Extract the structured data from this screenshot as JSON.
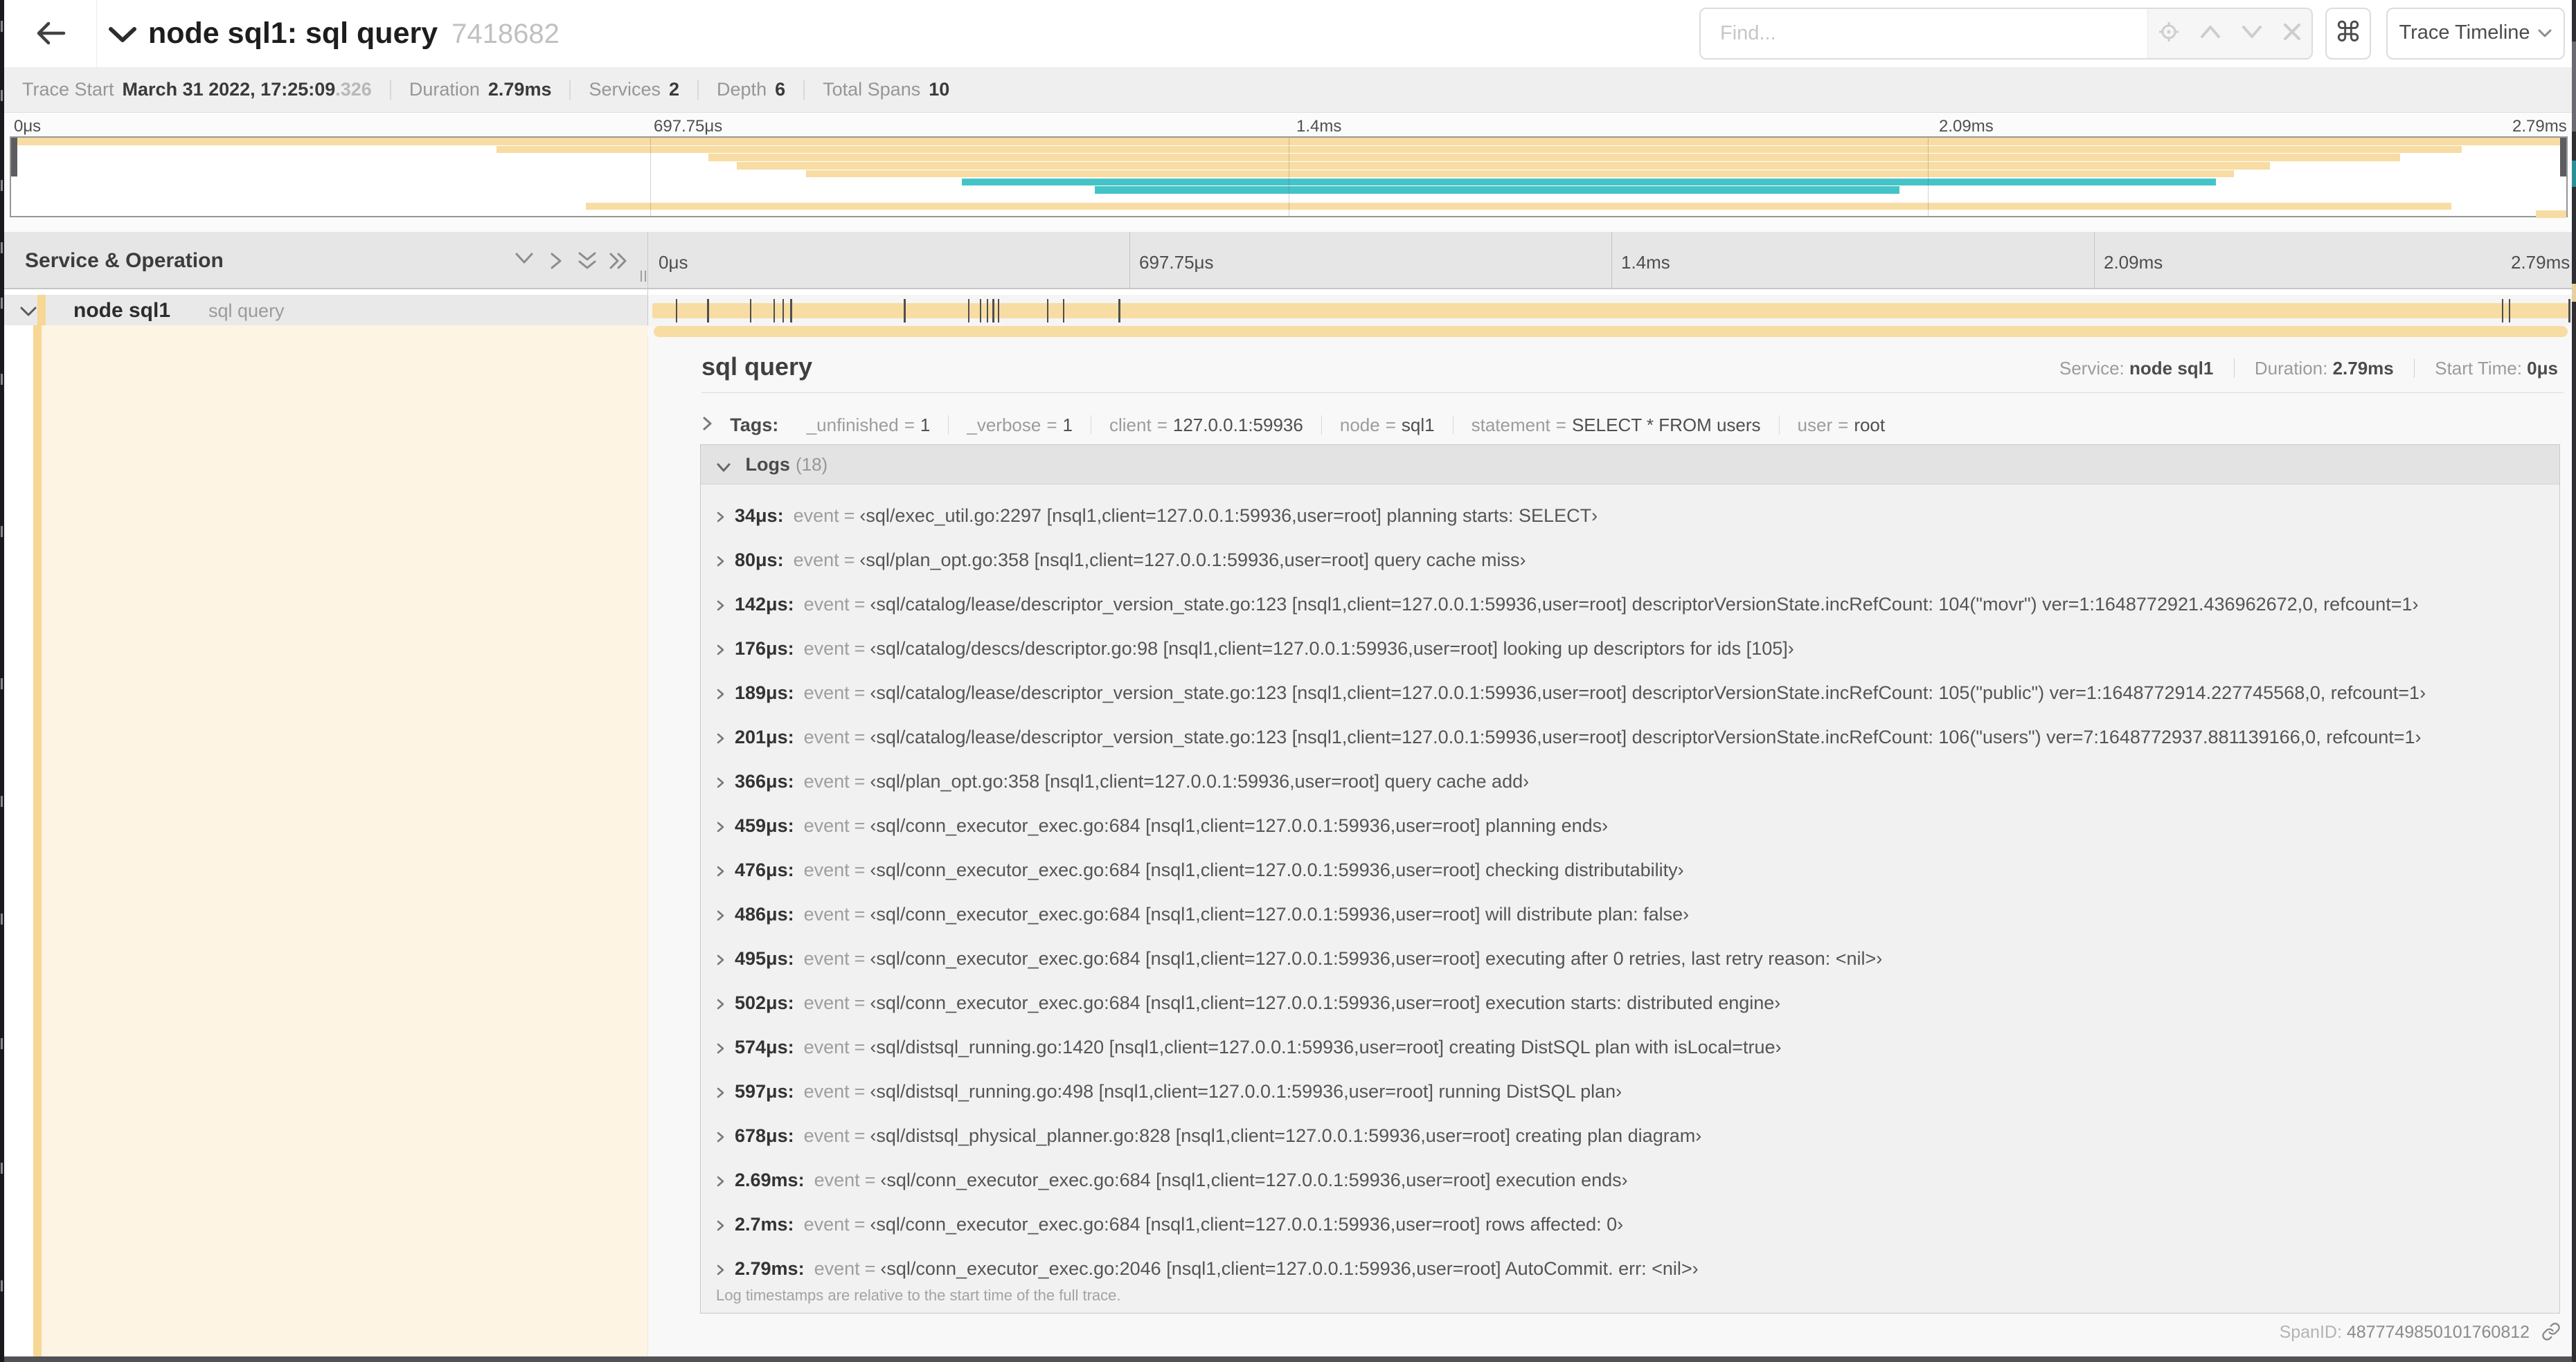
{
  "header": {
    "back": "←",
    "title": "node sql1: sql query",
    "trace_id": "7418682",
    "find_placeholder": "Find...",
    "cmd_label": "⌘",
    "view_dropdown": "Trace Timeline"
  },
  "stats": {
    "trace_start_label": "Trace Start",
    "trace_start": "March 31 2022, 17:25:09",
    "trace_start_frac": ".326",
    "duration_label": "Duration",
    "duration": "2.79ms",
    "services_label": "Services",
    "services": "2",
    "depth_label": "Depth",
    "depth": "6",
    "total_spans_label": "Total Spans",
    "total_spans": "10"
  },
  "colors": {
    "span_tan": "#f7dca3",
    "span_teal": "#45c4c8"
  },
  "minimap": {
    "ticks": [
      "0μs",
      "697.75μs",
      "1.4ms",
      "2.09ms",
      "2.79ms"
    ],
    "spans": [
      {
        "row": 0,
        "start": 0.0,
        "end": 1.0,
        "color": "tan"
      },
      {
        "row": 1,
        "start": 0.19,
        "end": 0.959,
        "color": "tan"
      },
      {
        "row": 2,
        "start": 0.273,
        "end": 0.935,
        "color": "tan"
      },
      {
        "row": 3,
        "start": 0.284,
        "end": 0.884,
        "color": "tan"
      },
      {
        "row": 4,
        "start": 0.311,
        "end": 0.87,
        "color": "tan"
      },
      {
        "row": 5,
        "start": 0.372,
        "end": 0.863,
        "color": "teal"
      },
      {
        "row": 6,
        "start": 0.424,
        "end": 0.739,
        "color": "teal"
      },
      {
        "row": 8,
        "start": 0.225,
        "end": 0.955,
        "color": "tan"
      },
      {
        "row": 9,
        "start": 0.988,
        "end": 1.0,
        "color": "tan"
      }
    ]
  },
  "timeline": {
    "left_header": "Service & Operation",
    "ticks": [
      "0μs",
      "697.75μs",
      "1.4ms",
      "2.09ms",
      "2.79ms"
    ]
  },
  "span_row": {
    "service": "node sql1",
    "operation": "sql query",
    "event_fractions": [
      0.0122,
      0.0287,
      0.0509,
      0.0631,
      0.0677,
      0.072,
      0.1312,
      0.1645,
      0.1706,
      0.1742,
      0.1774,
      0.18,
      0.2057,
      0.214,
      0.243,
      0.9642,
      0.9677,
      0.999
    ]
  },
  "detail": {
    "title": "sql query",
    "service_label": "Service:",
    "service": "node sql1",
    "duration_label": "Duration:",
    "duration": "2.79ms",
    "start_time_label": "Start Time:",
    "start_time": "0μs",
    "tags_label": "Tags:",
    "tags": [
      {
        "key": "_unfinished",
        "value": "1"
      },
      {
        "key": "_verbose",
        "value": "1"
      },
      {
        "key": "client",
        "value": "127.0.0.1:59936"
      },
      {
        "key": "node",
        "value": "sql1"
      },
      {
        "key": "statement",
        "value": "SELECT * FROM users"
      },
      {
        "key": "user",
        "value": "root"
      }
    ],
    "logs_label": "Logs",
    "logs_count": "(18)",
    "log_field": "event",
    "logs": [
      {
        "time": "34μs:",
        "value": "‹sql/exec_util.go:2297 [nsql1,client=127.0.0.1:59936,user=root] planning starts: SELECT›"
      },
      {
        "time": "80μs:",
        "value": "‹sql/plan_opt.go:358 [nsql1,client=127.0.0.1:59936,user=root] query cache miss›"
      },
      {
        "time": "142μs:",
        "value": "‹sql/catalog/lease/descriptor_version_state.go:123 [nsql1,client=127.0.0.1:59936,user=root] descriptorVersionState.incRefCount: 104(\"movr\") ver=1:1648772921.436962672,0, refcount=1›"
      },
      {
        "time": "176μs:",
        "value": "‹sql/catalog/descs/descriptor.go:98 [nsql1,client=127.0.0.1:59936,user=root] looking up descriptors for ids [105]›"
      },
      {
        "time": "189μs:",
        "value": "‹sql/catalog/lease/descriptor_version_state.go:123 [nsql1,client=127.0.0.1:59936,user=root] descriptorVersionState.incRefCount: 105(\"public\") ver=1:1648772914.227745568,0, refcount=1›"
      },
      {
        "time": "201μs:",
        "value": "‹sql/catalog/lease/descriptor_version_state.go:123 [nsql1,client=127.0.0.1:59936,user=root] descriptorVersionState.incRefCount: 106(\"users\") ver=7:1648772937.881139166,0, refcount=1›"
      },
      {
        "time": "366μs:",
        "value": "‹sql/plan_opt.go:358 [nsql1,client=127.0.0.1:59936,user=root] query cache add›"
      },
      {
        "time": "459μs:",
        "value": "‹sql/conn_executor_exec.go:684 [nsql1,client=127.0.0.1:59936,user=root] planning ends›"
      },
      {
        "time": "476μs:",
        "value": "‹sql/conn_executor_exec.go:684 [nsql1,client=127.0.0.1:59936,user=root] checking distributability›"
      },
      {
        "time": "486μs:",
        "value": "‹sql/conn_executor_exec.go:684 [nsql1,client=127.0.0.1:59936,user=root] will distribute plan: false›"
      },
      {
        "time": "495μs:",
        "value": "‹sql/conn_executor_exec.go:684 [nsql1,client=127.0.0.1:59936,user=root] executing after 0 retries, last retry reason: <nil>›"
      },
      {
        "time": "502μs:",
        "value": "‹sql/conn_executor_exec.go:684 [nsql1,client=127.0.0.1:59936,user=root] execution starts: distributed engine›"
      },
      {
        "time": "574μs:",
        "value": "‹sql/distsql_running.go:1420 [nsql1,client=127.0.0.1:59936,user=root] creating DistSQL plan with isLocal=true›"
      },
      {
        "time": "597μs:",
        "value": "‹sql/distsql_running.go:498 [nsql1,client=127.0.0.1:59936,user=root] running DistSQL plan›"
      },
      {
        "time": "678μs:",
        "value": "‹sql/distsql_physical_planner.go:828 [nsql1,client=127.0.0.1:59936,user=root] creating plan diagram›"
      },
      {
        "time": "2.69ms:",
        "value": "‹sql/conn_executor_exec.go:684 [nsql1,client=127.0.0.1:59936,user=root] execution ends›"
      },
      {
        "time": "2.7ms:",
        "value": "‹sql/conn_executor_exec.go:684 [nsql1,client=127.0.0.1:59936,user=root] rows affected: 0›"
      },
      {
        "time": "2.79ms:",
        "value": "‹sql/conn_executor_exec.go:2046 [nsql1,client=127.0.0.1:59936,user=root] AutoCommit. err: <nil>›"
      }
    ],
    "logs_footer": "Log timestamps are relative to the start time of the full trace.",
    "span_id_label": "SpanID:",
    "span_id": "4877749850101760812"
  }
}
